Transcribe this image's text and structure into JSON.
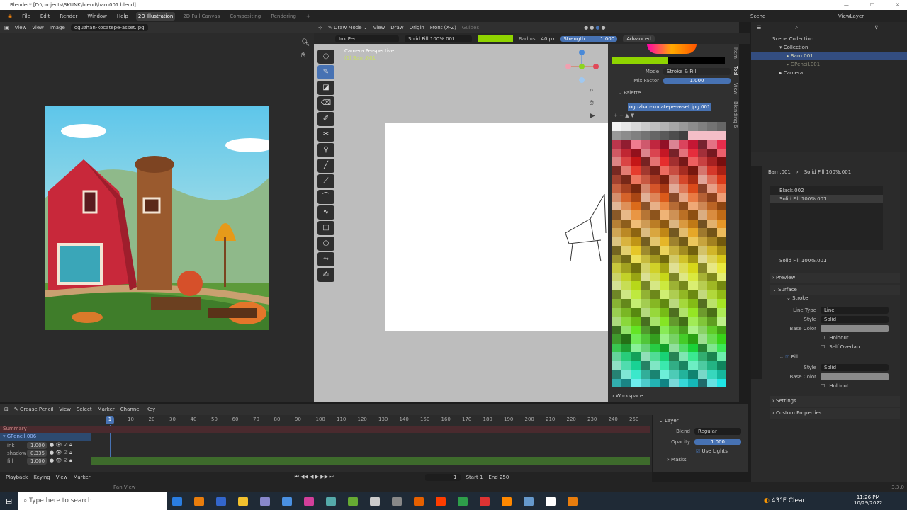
{
  "window": {
    "title": "Blender* [D:\\projects\\SKUNK\\blend\\barn001.blend]",
    "controls": [
      "—",
      "☐",
      "✕"
    ]
  },
  "menu": {
    "items": [
      "File",
      "Edit",
      "Render",
      "Window",
      "Help"
    ],
    "workspaces": [
      "2D Illustration",
      "2D Full Canvas",
      "Compositing",
      "Rendering"
    ],
    "add": "+",
    "scene": "Scene",
    "view_layer": "ViewLayer"
  },
  "image_editor": {
    "menus": [
      "View",
      "View",
      "Image"
    ],
    "image_name": "oguzhan-kocatepe-asset.jpg"
  },
  "viewport": {
    "mode": "Draw Mode",
    "menus": [
      "View",
      "Draw"
    ],
    "origin": "Origin",
    "view": "Front (X-Z)",
    "guides": "Guides",
    "brush": "Ink Pen",
    "material": "Solid Fill 100%.001",
    "radius_label": "Radius",
    "radius_value": "40 px",
    "strength_label": "Strength",
    "strength_value": "1.000",
    "advanced": "Advanced",
    "overlay_title": "Camera Perspective",
    "overlay_sub": "(1) Barn.001",
    "brush_color": "#8fd400"
  },
  "npanel": {
    "mode_label": "Mode",
    "mode_value": "Stroke & Fill",
    "mix_label": "Mix Factor",
    "mix_value": "1.000",
    "palette_label": "Palette",
    "palette_name": "oguzhan-kocatepe-asset.jpg.001",
    "workspace": "Workspace",
    "tabs": [
      "Item",
      "Tool",
      "View",
      "Blending 6"
    ]
  },
  "outliner": {
    "items": [
      {
        "label": "Scene Collection"
      },
      {
        "label": "Collection"
      },
      {
        "label": "Barn.001"
      },
      {
        "label": "GPencil.001"
      },
      {
        "label": "Camera"
      }
    ]
  },
  "properties": {
    "breadcrumb_obj": "Barn.001",
    "breadcrumb_mat": "Solid Fill 100%.001",
    "slots": [
      "Black.002",
      "Solid Fill 100%.001"
    ],
    "material_name": "Solid Fill 100%.001",
    "preview": "Preview",
    "surface": "Surface",
    "stroke": "Stroke",
    "line_type_label": "Line Type",
    "line_type": "Line",
    "style_label": "Style",
    "style": "Solid",
    "base_color_label": "Base Color",
    "holdout": "Holdout",
    "self_overlap": "Self Overlap",
    "fill": "Fill",
    "fill_style": "Solid",
    "settings": "Settings",
    "custom_props": "Custom Properties"
  },
  "timeline": {
    "mode": "Grease Pencil",
    "menus": [
      "View",
      "Select",
      "Marker",
      "Channel",
      "Key"
    ],
    "current_frame": "1",
    "ticks": [
      "10",
      "20",
      "30",
      "40",
      "50",
      "60",
      "70",
      "80",
      "90",
      "100",
      "110",
      "120",
      "130",
      "140",
      "150",
      "160",
      "170",
      "180",
      "190",
      "200",
      "210",
      "220",
      "230",
      "240",
      "250"
    ],
    "summary": "Summary",
    "object": "GPencil.006",
    "layers": [
      {
        "name": "ink",
        "value": "1.000"
      },
      {
        "name": "shadow",
        "value": "0.335"
      },
      {
        "name": "fill",
        "value": "1.000"
      }
    ],
    "playback_menus": [
      "Playback",
      "Keying",
      "View",
      "Marker"
    ],
    "frame": "1",
    "start_label": "Start",
    "start": "1",
    "end_label": "End",
    "end": "250"
  },
  "layer_panel": {
    "title": "Layer",
    "blend_label": "Blend",
    "blend": "Regular",
    "opacity_label": "Opacity",
    "opacity": "1.000",
    "use_lights": "Use Lights",
    "masks": "Masks"
  },
  "statusbar": {
    "hint": "Pan View",
    "version": "3.3.0"
  },
  "taskbar": {
    "search_placeholder": "Type here to search",
    "weather": "43°F Clear",
    "time": "11:26 PM",
    "date": "10/29/2022"
  }
}
